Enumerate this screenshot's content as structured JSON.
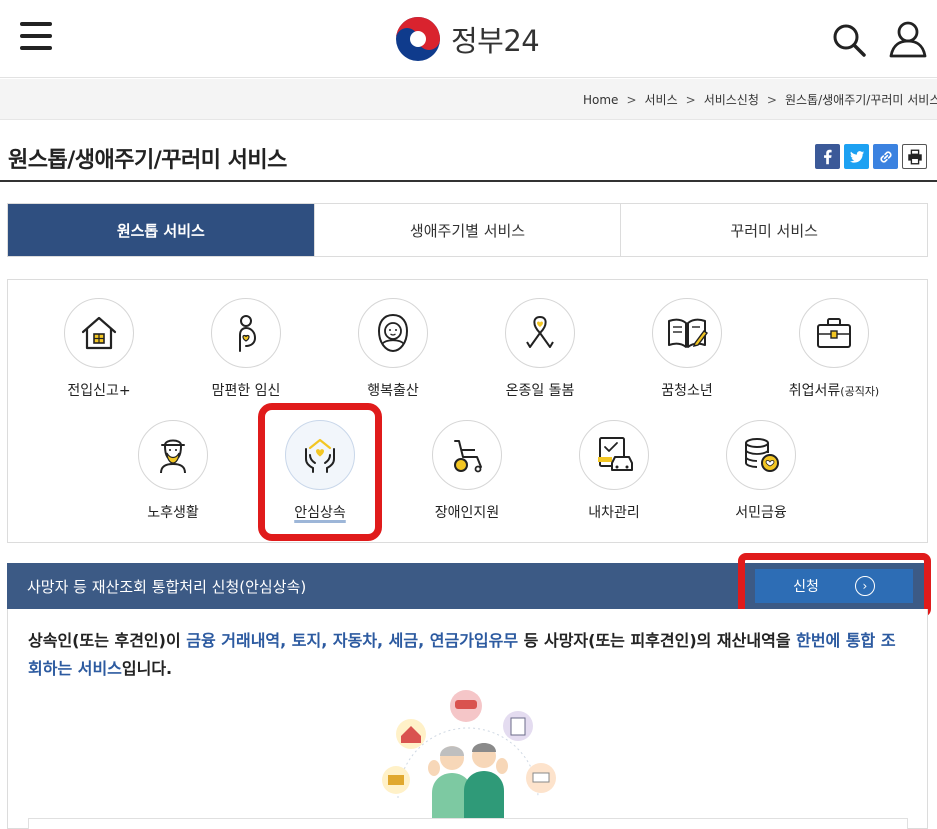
{
  "header": {
    "logo_text": "정부24"
  },
  "breadcrumb": [
    "Home",
    "서비스",
    "서비스신청",
    "원스톱/생애주기/꾸러미 서비스"
  ],
  "page": {
    "title": "원스톱/생애주기/꾸러미 서비스"
  },
  "tabs": [
    {
      "label": "원스톱 서비스",
      "active": true
    },
    {
      "label": "생애주기별 서비스",
      "active": false
    },
    {
      "label": "꾸러미 서비스",
      "active": false
    }
  ],
  "services": {
    "row1": [
      "전입신고+",
      "맘편한 임신",
      "행복출산",
      "온종일 돌봄",
      "꿈청소년"
    ],
    "job_main": "취업서류",
    "job_sub": "(공직자)",
    "row2": [
      "노후생활",
      "안심상속",
      "장애인지원",
      "내차관리",
      "서민금융"
    ],
    "selected": "안심상속"
  },
  "result": {
    "title": "사망자 등 재산조회 통합처리 신청(안심상속)",
    "apply_label": "신청",
    "arrow_glyph": "›"
  },
  "description": {
    "p1": "상속인(또는 후견인)이 ",
    "h1": "금융 거래내역, 토지, 자동차, 세금, 연금가입유무",
    "p2": " 등 사망자(또는 피후견인)의 재산내역을 ",
    "h2": "한번에 통합 조회하는 서비스",
    "p3": "입니다."
  },
  "colors": {
    "primary_navy": "#2f4f80",
    "bar_navy": "#3c5a85",
    "apply_blue": "#2d6db5",
    "highlight_red": "#e01b1b",
    "icon_yellow": "#f3c623",
    "link_blue": "#2c5aa0"
  }
}
